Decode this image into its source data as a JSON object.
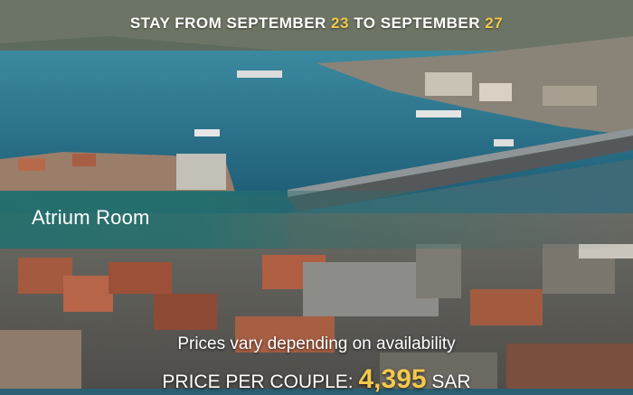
{
  "header": {
    "stay_prefix": "STAY FROM SEPTEMBER",
    "start_day": "23",
    "middle": "TO SEPTEMBER",
    "end_day": "27"
  },
  "room": {
    "name": "Atrium Room"
  },
  "availability": {
    "note": "Prices vary depending on availability"
  },
  "price": {
    "label": "PRICE PER COUPLE:",
    "amount": "4,395",
    "currency": "SAR"
  },
  "colors": {
    "accent": "#f2c94c",
    "band": "#24706e",
    "water": "#2b6f86"
  },
  "background": {
    "icon": "aerial-city-photo"
  }
}
